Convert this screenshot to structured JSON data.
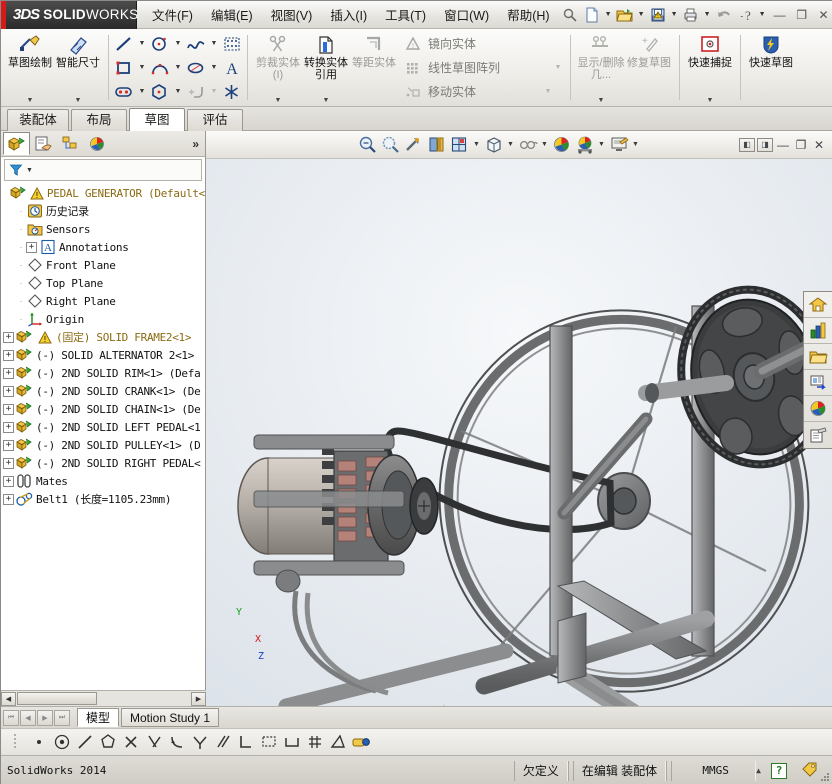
{
  "app": {
    "brand_ds": "3DS",
    "brand_name": "SOLIDWORKS",
    "version_status": "SolidWorks 2014"
  },
  "menubar": {
    "items": [
      {
        "label": "文件(F)",
        "name": "menu-file"
      },
      {
        "label": "编辑(E)",
        "name": "menu-edit"
      },
      {
        "label": "视图(V)",
        "name": "menu-view"
      },
      {
        "label": "插入(I)",
        "name": "menu-insert"
      },
      {
        "label": "工具(T)",
        "name": "menu-tools"
      },
      {
        "label": "窗口(W)",
        "name": "menu-window"
      },
      {
        "label": "帮助(H)",
        "name": "menu-help"
      }
    ],
    "quick_access": [
      {
        "name": "pin-icon",
        "glyph": "search"
      },
      {
        "name": "new-document-icon",
        "glyph": "page"
      },
      {
        "name": "open-document-icon",
        "glyph": "folder"
      },
      {
        "name": "save-icon",
        "glyph": "save"
      },
      {
        "name": "print-icon",
        "glyph": "printer"
      },
      {
        "name": "undo-icon",
        "glyph": "undo"
      },
      {
        "name": "help-icon",
        "glyph": "question"
      }
    ],
    "window_buttons": {
      "minimize": "—",
      "restore": "❐",
      "close": "✕"
    }
  },
  "ribbon": {
    "groups": [
      {
        "name": "sketch-group",
        "buttons": [
          {
            "label": "草图绘制",
            "name": "sketch-button",
            "enabled": true,
            "has_caret": true
          },
          {
            "label": "智能尺寸",
            "name": "smart-dimension-button",
            "enabled": true,
            "has_caret": true
          }
        ]
      },
      {
        "name": "entities-group",
        "rows": [
          [
            {
              "name": "line-icon",
              "drop": true
            },
            {
              "name": "circle-icon",
              "drop": true
            },
            {
              "name": "spline-icon",
              "drop": true
            },
            {
              "name": "sketch-pattern-icon",
              "drop": false
            }
          ],
          [
            {
              "name": "rectangle-icon",
              "drop": true
            },
            {
              "name": "arc-icon",
              "drop": true
            },
            {
              "name": "ellipse-icon",
              "drop": true
            },
            {
              "name": "text-icon",
              "drop": false
            }
          ],
          [
            {
              "name": "slot-icon",
              "drop": true
            },
            {
              "name": "polygon-icon",
              "drop": true
            },
            {
              "name": "fillet-icon",
              "drop": true
            },
            {
              "name": "point-icon",
              "drop": false
            }
          ]
        ]
      },
      {
        "name": "trim-group",
        "buttons": [
          {
            "label": "剪裁实体(I)",
            "name": "trim-entities-button",
            "enabled": false,
            "has_caret": true
          },
          {
            "label": "转换实体引用",
            "name": "convert-entities-button",
            "enabled": true,
            "has_caret": true
          },
          {
            "label": "等距实体",
            "name": "offset-entities-button",
            "enabled": false,
            "has_caret": false
          }
        ],
        "text_rows": [
          {
            "label": "镜向实体",
            "name": "mirror-entities-item",
            "enabled": false,
            "drop": false
          },
          {
            "label": "线性草图阵列",
            "name": "linear-sketch-pattern-item",
            "enabled": false,
            "drop": true
          },
          {
            "label": "移动实体",
            "name": "move-entities-item",
            "enabled": false,
            "drop": true
          }
        ]
      },
      {
        "name": "display-group",
        "buttons": [
          {
            "label": "显示/删除几...",
            "name": "display-delete-relations-button",
            "enabled": false,
            "has_caret": true
          },
          {
            "label": "修复草图",
            "name": "repair-sketch-button",
            "enabled": false,
            "has_caret": false
          }
        ]
      },
      {
        "name": "snap-group",
        "buttons": [
          {
            "label": "快速捕捉",
            "name": "quick-snaps-button",
            "enabled": true,
            "has_caret": true
          }
        ]
      },
      {
        "name": "rapid-sketch-group",
        "buttons": [
          {
            "label": "快速草图",
            "name": "rapid-sketch-button",
            "enabled": true,
            "has_caret": false
          }
        ]
      }
    ]
  },
  "command_tabs": [
    {
      "label": "装配体",
      "name": "tab-assembly",
      "active": false
    },
    {
      "label": "布局",
      "name": "tab-layout",
      "active": false
    },
    {
      "label": "草图",
      "name": "tab-sketch",
      "active": true
    },
    {
      "label": "评估",
      "name": "tab-evaluate",
      "active": false
    }
  ],
  "left_panel": {
    "tabs": [
      {
        "name": "feature-manager-tab",
        "selected": true
      },
      {
        "name": "property-manager-tab",
        "selected": false
      },
      {
        "name": "configuration-manager-tab",
        "selected": false
      },
      {
        "name": "display-manager-tab",
        "selected": false
      }
    ],
    "more_glyph": "»",
    "filter_placeholder": "",
    "tree": [
      {
        "label": "PEDAL GENERATOR   (Default<",
        "name": "tree-item-root",
        "icon": "assembly-icon",
        "warn": true,
        "expandable": false,
        "indent": 0,
        "style": "root"
      },
      {
        "label": "历史记录",
        "name": "tree-item-history",
        "icon": "history-icon",
        "warn": false,
        "expandable": false,
        "indent": 1,
        "style": "normal"
      },
      {
        "label": "Sensors",
        "name": "tree-item-sensors",
        "icon": "sensors-icon",
        "warn": false,
        "expandable": false,
        "indent": 1,
        "style": "normal"
      },
      {
        "label": "Annotations",
        "name": "tree-item-annotations",
        "icon": "annotations-icon",
        "warn": false,
        "expandable": true,
        "indent": 1,
        "style": "normal"
      },
      {
        "label": "Front Plane",
        "name": "tree-item-front-plane",
        "icon": "plane-icon",
        "warn": false,
        "expandable": false,
        "indent": 1,
        "style": "normal"
      },
      {
        "label": "Top Plane",
        "name": "tree-item-top-plane",
        "icon": "plane-icon",
        "warn": false,
        "expandable": false,
        "indent": 1,
        "style": "normal"
      },
      {
        "label": "Right Plane",
        "name": "tree-item-right-plane",
        "icon": "plane-icon",
        "warn": false,
        "expandable": false,
        "indent": 1,
        "style": "normal"
      },
      {
        "label": "Origin",
        "name": "tree-item-origin",
        "icon": "origin-icon",
        "warn": false,
        "expandable": false,
        "indent": 1,
        "style": "normal"
      },
      {
        "label": "(固定) SOLID FRAME2<1>",
        "name": "tree-item-solid-frame2",
        "icon": "part-icon",
        "warn": true,
        "expandable": true,
        "indent": 0,
        "style": "fixed"
      },
      {
        "label": "(-) SOLID ALTERNATOR 2<1>",
        "name": "tree-item-solid-alternator-2",
        "icon": "part-icon",
        "warn": false,
        "expandable": true,
        "indent": 0,
        "style": "normal"
      },
      {
        "label": "(-) 2ND SOLID RIM<1> (Defa",
        "name": "tree-item-2nd-solid-rim",
        "icon": "part-icon",
        "warn": false,
        "expandable": true,
        "indent": 0,
        "style": "normal"
      },
      {
        "label": "(-) 2ND SOLID CRANK<1> (De",
        "name": "tree-item-2nd-solid-crank",
        "icon": "part-icon",
        "warn": false,
        "expandable": true,
        "indent": 0,
        "style": "normal"
      },
      {
        "label": "(-) 2ND SOLID CHAIN<1> (De",
        "name": "tree-item-2nd-solid-chain",
        "icon": "part-icon",
        "warn": false,
        "expandable": true,
        "indent": 0,
        "style": "normal"
      },
      {
        "label": "(-) 2ND SOLID LEFT PEDAL<1",
        "name": "tree-item-2nd-solid-left-pedal",
        "icon": "part-icon",
        "warn": false,
        "expandable": true,
        "indent": 0,
        "style": "normal"
      },
      {
        "label": "(-) 2ND SOLID PULLEY<1> (D",
        "name": "tree-item-2nd-solid-pulley",
        "icon": "part-icon",
        "warn": false,
        "expandable": true,
        "indent": 0,
        "style": "normal"
      },
      {
        "label": "(-) 2ND SOLID RIGHT PEDAL<",
        "name": "tree-item-2nd-solid-right-pedal",
        "icon": "part-icon",
        "warn": false,
        "expandable": true,
        "indent": 0,
        "style": "normal"
      },
      {
        "label": "Mates",
        "name": "tree-item-mates",
        "icon": "mates-icon",
        "warn": false,
        "expandable": true,
        "indent": 0,
        "style": "normal"
      },
      {
        "label": "Belt1  (长度=1105.23mm)",
        "name": "tree-item-belt1",
        "icon": "belt-icon",
        "warn": false,
        "expandable": true,
        "indent": 0,
        "style": "normal"
      }
    ]
  },
  "view_toolbar": {
    "buttons": [
      {
        "name": "zoom-to-fit-icon",
        "drop": false
      },
      {
        "name": "zoom-to-area-icon",
        "drop": false
      },
      {
        "name": "previous-view-icon",
        "drop": false
      },
      {
        "name": "section-view-icon",
        "drop": false
      },
      {
        "name": "view-orientation-icon",
        "drop": true
      },
      {
        "name": "display-style-icon",
        "drop": true
      },
      {
        "name": "hide-show-items-icon",
        "drop": true
      },
      {
        "name": "edit-appearance-icon",
        "drop": false
      },
      {
        "name": "apply-scene-icon",
        "drop": true
      },
      {
        "name": "view-settings-icon",
        "drop": true
      }
    ],
    "window_controls": [
      {
        "name": "tile-left-icon",
        "glyph": "◧"
      },
      {
        "name": "tile-right-icon",
        "glyph": "◨"
      },
      {
        "name": "minimize-doc-icon",
        "glyph": "—"
      },
      {
        "name": "restore-doc-icon",
        "glyph": "❐"
      },
      {
        "name": "close-doc-icon",
        "glyph": "✕"
      }
    ]
  },
  "task_pane": [
    {
      "name": "solidworks-resources-icon"
    },
    {
      "name": "design-library-icon"
    },
    {
      "name": "file-explorer-icon"
    },
    {
      "name": "view-palette-icon"
    },
    {
      "name": "appearances-scenes-icon"
    },
    {
      "name": "custom-properties-icon"
    }
  ],
  "triad": {
    "x_label": "X",
    "y_label": "Y",
    "z_label": "Z"
  },
  "bottom_tabs": {
    "nav": [
      "⏮",
      "◀",
      "▶",
      "⏭"
    ],
    "tabs": [
      {
        "label": "模型",
        "name": "bottom-tab-model",
        "selected": true
      },
      {
        "label": "Motion Study 1",
        "name": "bottom-tab-motion-study-1",
        "selected": false
      }
    ]
  },
  "sketch_toolbar": [
    {
      "name": "point-relation-icon"
    },
    {
      "name": "concentric-relation-icon"
    },
    {
      "name": "collinear-relation-icon"
    },
    {
      "name": "tangent-relation-icon"
    },
    {
      "name": "intersection-relation-icon"
    },
    {
      "name": "coincident-relation-icon"
    },
    {
      "name": "midpoint-relation-icon"
    },
    {
      "name": "symmetric-relation-icon"
    },
    {
      "name": "parallel-relation-icon"
    },
    {
      "name": "perpendicular-relation-icon"
    },
    {
      "name": "equal-relation-icon"
    },
    {
      "name": "horizontal-relation-icon"
    },
    {
      "name": "grid-relation-icon"
    },
    {
      "name": "angle-relation-icon"
    },
    {
      "name": "fix-relation-icon"
    }
  ],
  "statusbar": {
    "message": "SolidWorks 2014",
    "state": "欠定义",
    "edit_mode": "在编辑 装配体",
    "units": "MMGS",
    "units_caret": "▲",
    "help_badge": "?",
    "tag_icon": "tag-icon"
  }
}
